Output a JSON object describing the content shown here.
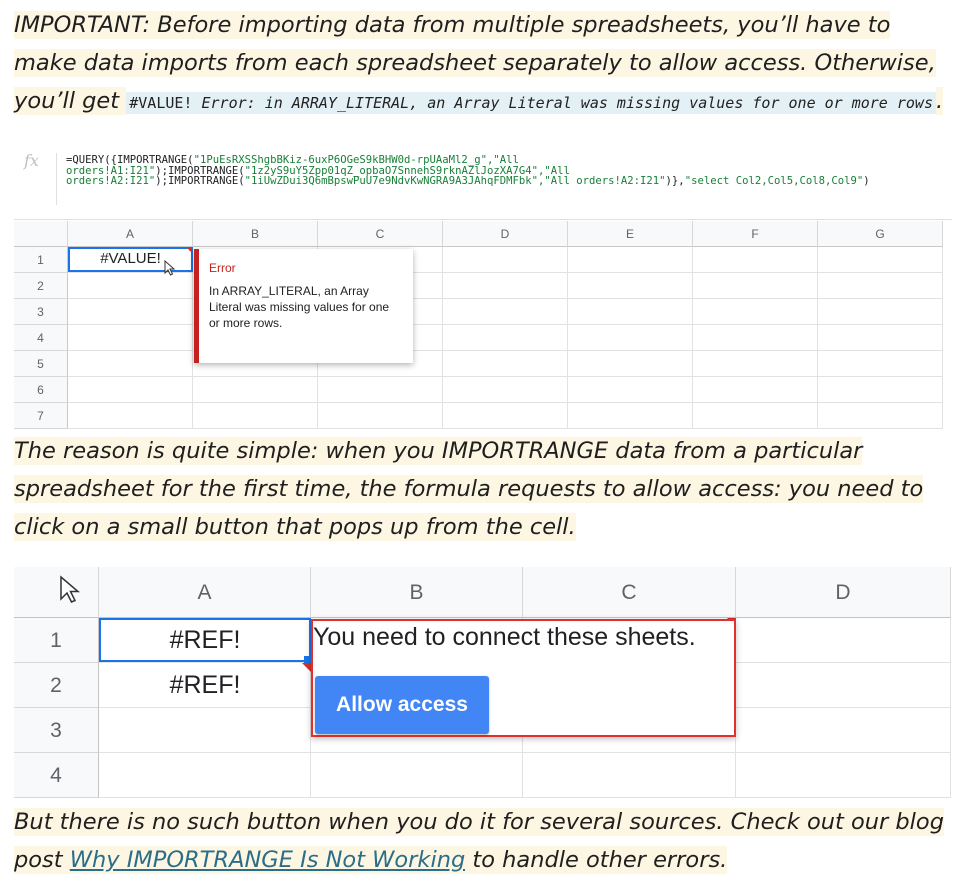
{
  "intro": {
    "lead": "IMPORTANT: Before importing data from multiple spreadsheets, you’ll have to make data imports from each spreadsheet separately to allow access. Otherwise, you’ll get ",
    "code_value": "#VALUE!",
    "code_error": "Error:",
    "code_message": "in ARRAY_LITERAL, an Array Literal was missing values for one or more rows",
    "tail": "."
  },
  "shot1": {
    "fx_label": "fx",
    "formula": {
      "l1a": "=QUERY({IMPORTRANGE(",
      "l1b": "\"1PuEsRXSShgbBKiz-6uxP6OGeS9kBHW0d-rpUAaMl2_g\",\"All",
      "l2a": "orders!A1:I21\"",
      "l2b": ");IMPORTRANGE(",
      "l2c": "\"1z2yS9uY5Zpp01qZ_opbaO7SnnehS9rknAZlJozXA7G4\",\"All",
      "l3a": "orders!A2:I21\"",
      "l3b": ");IMPORTRANGE(",
      "l3c": "\"1iUwZDui3Q6mBpswPuU7e9NdvKwNGRA9A3JAhqFDMFbk\",\"All orders!A2:I21\"",
      "l3d": ")},",
      "l3e": "\"select Col2,Col5,Col8,Col9\"",
      "l3f": ")"
    },
    "columns": [
      "A",
      "B",
      "C",
      "D",
      "E",
      "F",
      "G"
    ],
    "rows": [
      "1",
      "2",
      "3",
      "4",
      "5",
      "6",
      "7"
    ],
    "cell_a1": "#VALUE!",
    "error_title": "Error",
    "error_body": "In ARRAY_LITERAL, an Array Literal was missing values for one or more rows."
  },
  "middle": "The reason is quite simple: when you IMPORTRANGE data from a particular spreadsheet for the first time, the formula requests to allow access: you need to click on a small button that pops up from the cell.",
  "shot2": {
    "columns": [
      "A",
      "B",
      "C",
      "D"
    ],
    "rows": [
      "1",
      "2",
      "3",
      "4"
    ],
    "cell_a1": "#REF!",
    "cell_a2": "#REF!",
    "popup_text": "You need to connect these sheets.",
    "button_label": "Allow access"
  },
  "outro": {
    "lead": "But there is no such button when you do it for several sources. Check out our blog post ",
    "link": "Why IMPORTRANGE Is Not Working",
    "tail": " to handle other errors."
  }
}
